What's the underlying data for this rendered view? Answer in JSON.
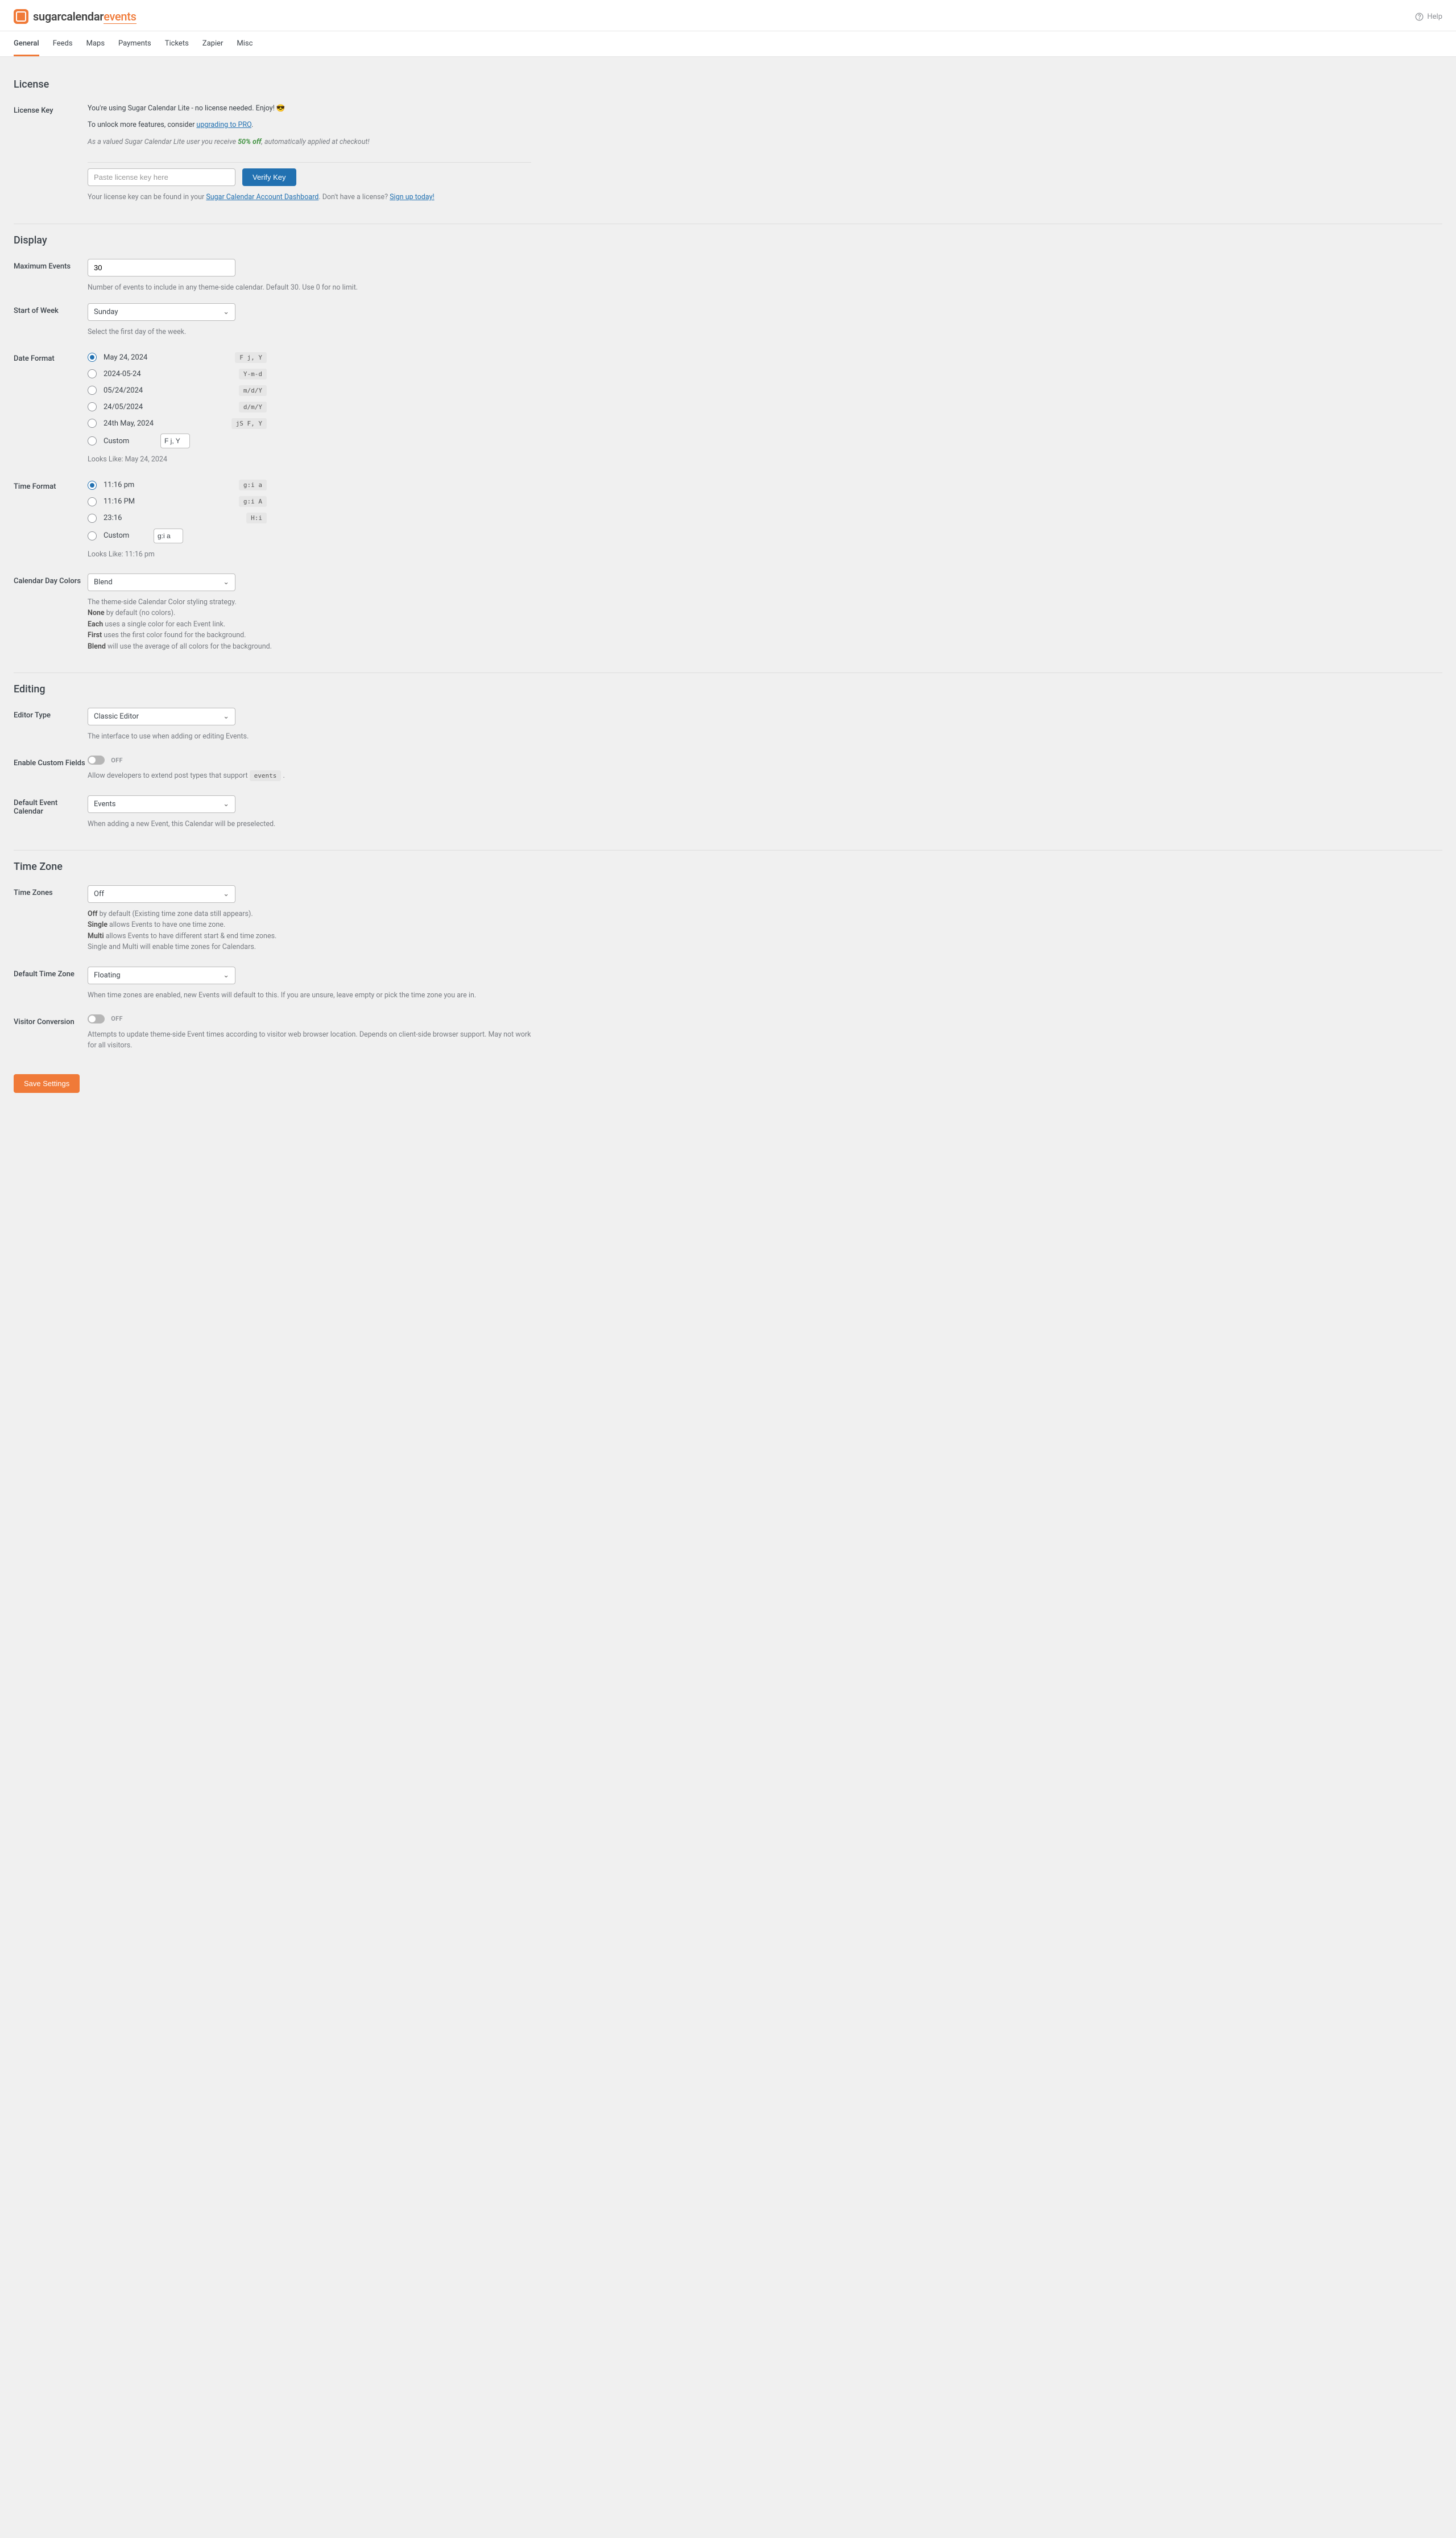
{
  "header": {
    "logo_part1": "sugarcalendar",
    "logo_part2": "events",
    "help": "Help"
  },
  "tabs": [
    "General",
    "Feeds",
    "Maps",
    "Payments",
    "Tickets",
    "Zapier",
    "Misc"
  ],
  "license": {
    "title": "License",
    "label": "License Key",
    "line1": "You're using Sugar Calendar Lite - no license needed. Enjoy! 😎",
    "line2a": "To unlock more features, consider ",
    "line2link": "upgrading to PRO",
    "line2b": ".",
    "line3a": "As a valued Sugar Calendar Lite user you receive ",
    "line3bold": "50% off",
    "line3b": ", automatically applied at checkout!",
    "placeholder": "Paste license key here",
    "verify": "Verify Key",
    "help1": "Your license key can be found in your ",
    "helplink1": "Sugar Calendar Account Dashboard",
    "help2": ". Don't have a license? ",
    "helplink2": "Sign up today!"
  },
  "display": {
    "title": "Display",
    "max_label": "Maximum Events",
    "max_value": "30",
    "max_desc": "Number of events to include in any theme-side calendar. Default 30. Use 0 for no limit.",
    "sow_label": "Start of Week",
    "sow_value": "Sunday",
    "sow_desc": "Select the first day of the week.",
    "df_label": "Date Format",
    "df_options": [
      {
        "label": "May 24, 2024",
        "code": "F j, Y",
        "checked": true
      },
      {
        "label": "2024-05-24",
        "code": "Y-m-d"
      },
      {
        "label": "05/24/2024",
        "code": "m/d/Y"
      },
      {
        "label": "24/05/2024",
        "code": "d/m/Y"
      },
      {
        "label": "24th May, 2024",
        "code": "jS F, Y"
      }
    ],
    "df_custom": "Custom",
    "df_custom_value": "F j, Y",
    "df_preview_label": "Looks Like: ",
    "df_preview_value": "May 24, 2024",
    "tf_label": "Time Format",
    "tf_options": [
      {
        "label": "11:16 pm",
        "code": "g:i a",
        "checked": true
      },
      {
        "label": "11:16 PM",
        "code": "g:i A"
      },
      {
        "label": "23:16",
        "code": "H:i"
      }
    ],
    "tf_custom": "Custom",
    "tf_custom_value": "g:i a",
    "tf_preview_label": "Looks Like: ",
    "tf_preview_value": "11:16 pm",
    "cdc_label": "Calendar Day Colors",
    "cdc_value": "Blend",
    "cdc_desc1": "The theme-side Calendar Color styling strategy.",
    "cdc_none_b": "None",
    "cdc_none_t": " by default (no colors).",
    "cdc_each_b": "Each",
    "cdc_each_t": " uses a single color for each Event link.",
    "cdc_first_b": "First",
    "cdc_first_t": " uses the first color found for the background.",
    "cdc_blend_b": "Blend",
    "cdc_blend_t": " will use the average of all colors for the background."
  },
  "editing": {
    "title": "Editing",
    "et_label": "Editor Type",
    "et_value": "Classic Editor",
    "et_desc": "The interface to use when adding or editing Events.",
    "ecf_label": "Enable Custom Fields",
    "ecf_state": "OFF",
    "ecf_desc_a": "Allow developers to extend post types that support ",
    "ecf_desc_code": "events",
    "ecf_desc_b": " .",
    "dec_label": "Default Event Calendar",
    "dec_value": "Events",
    "dec_desc": "When adding a new Event, this Calendar will be preselected."
  },
  "timezone": {
    "title": "Time Zone",
    "tz_label": "Time Zones",
    "tz_value": "Off",
    "tz_off_b": "Off",
    "tz_off_t": " by default (Existing time zone data still appears).",
    "tz_single_b": "Single",
    "tz_single_t": " allows Events to have one time zone.",
    "tz_multi_b": "Multi",
    "tz_multi_t": " allows Events to have different start & end time zones.",
    "tz_both": "Single and Multi will enable time zones for Calendars.",
    "dtz_label": "Default Time Zone",
    "dtz_value": "Floating",
    "dtz_desc": "When time zones are enabled, new Events will default to this. If you are unsure, leave empty or pick the time zone you are in.",
    "vc_label": "Visitor Conversion",
    "vc_state": "OFF",
    "vc_desc": "Attempts to update theme-side Event times according to visitor web browser location. Depends on client-side browser support. May not work for all visitors."
  },
  "save": "Save Settings"
}
